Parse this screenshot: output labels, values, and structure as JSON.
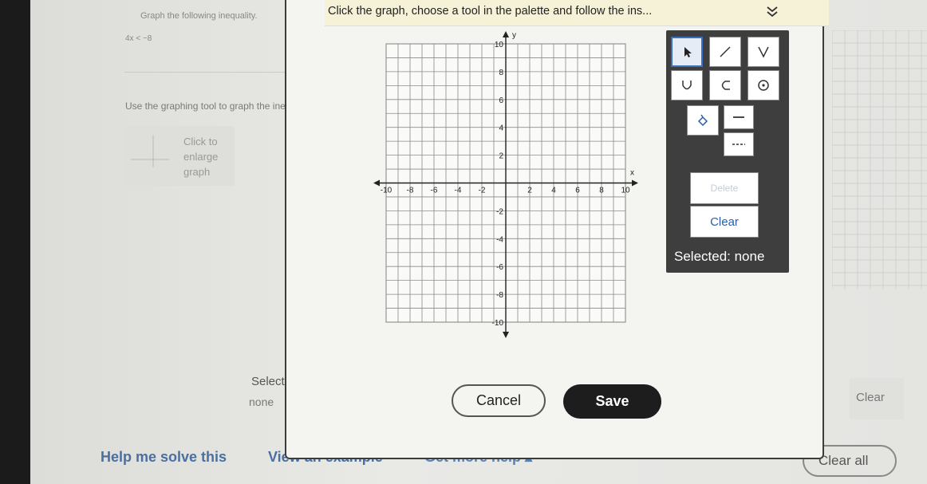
{
  "question": {
    "title": "Graph the following inequality.",
    "inequality": "4x < −8",
    "instruction": "Use the graphing tool to graph the ineq",
    "enlarge_label": "Click to enlarge graph"
  },
  "background": {
    "selected_label": "Selected:",
    "selected_value": "none",
    "clear_label": "Clear"
  },
  "dialog": {
    "instruction": "Click the graph, choose a tool in the palette and follow the ins...",
    "collapse_icon": "double-chevron-down-icon",
    "graph": {
      "x_axis_label": "x",
      "y_axis_label": "y",
      "x_ticks": [
        "-10",
        "-8",
        "-6",
        "-4",
        "-2",
        "2",
        "4",
        "6",
        "8",
        "10"
      ],
      "y_ticks": [
        "10",
        "8",
        "6",
        "4",
        "2",
        "-2",
        "-4",
        "-6",
        "-8",
        "-10"
      ],
      "xlim": [
        -10,
        10
      ],
      "ylim": [
        -10,
        10
      ],
      "grid_step": 1
    },
    "palette": {
      "tools": [
        {
          "name": "pointer",
          "icon": "pointer-arrow-icon"
        },
        {
          "name": "line",
          "icon": "line-icon"
        },
        {
          "name": "absolute-value",
          "icon": "v-shape-icon"
        },
        {
          "name": "parabola",
          "icon": "u-shape-icon"
        },
        {
          "name": "horizontal-parabola",
          "icon": "c-shape-icon"
        },
        {
          "name": "circle",
          "icon": "circle-dot-icon"
        },
        {
          "name": "fill",
          "icon": "paint-bucket-icon"
        },
        {
          "name": "solid-line",
          "icon": "solid-line-icon"
        },
        {
          "name": "dashed-line",
          "icon": "dashed-line-icon"
        }
      ],
      "delete_label": "Delete",
      "clear_label": "Clear",
      "selected_text": "Selected: none"
    },
    "cancel_label": "Cancel",
    "save_label": "Save"
  },
  "footer": {
    "help_link": "Help me solve this",
    "example_link": "View an example",
    "more_help_link": "Get more help ▴",
    "clear_all_label": "Clear all"
  },
  "colors": {
    "accent": "#2a5fa6",
    "palette_bg": "#3e3e3e",
    "header_bg": "#f6f2d8",
    "save_bg": "#1d1d1d"
  }
}
